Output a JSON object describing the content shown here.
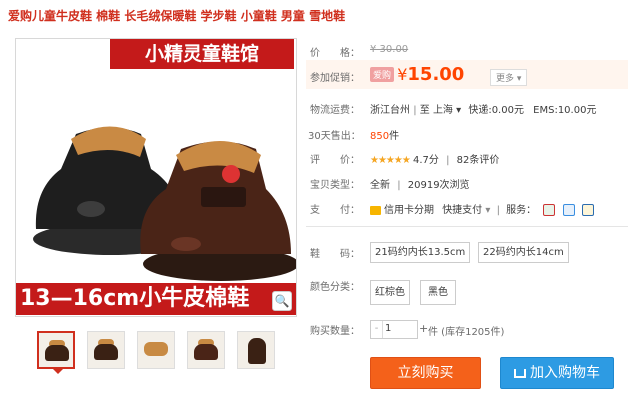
{
  "product": {
    "title": "爱购儿童牛皮鞋 棉鞋 长毛绒保暖鞋 学步鞋 小童鞋 男童 雪地鞋"
  },
  "image": {
    "banner_top": "小精灵童鞋馆",
    "banner_bottom": "13—16cm小牛皮棉鞋"
  },
  "price": {
    "label": "价　　格：",
    "original": "¥ 30.00",
    "promo_label": "参加促销：",
    "promo_tag": "爱购",
    "currency": "¥",
    "current": "15.00",
    "more_label": "更多 ▾"
  },
  "shipping": {
    "label": "物流运费：",
    "from": "浙江台州",
    "sep": "至",
    "to": "上海 ▾",
    "express": "快递:0.00元",
    "ems": "EMS:10.00元"
  },
  "sales": {
    "label": "30天售出：",
    "count": "850",
    "unit": "件"
  },
  "rating": {
    "label": "评　　价：",
    "stars": "★★★★★",
    "score": "4.7分",
    "sep": "|",
    "reviews": "82条评价"
  },
  "condition": {
    "label": "宝贝类型：",
    "value": "全新",
    "sep": "|",
    "views": "20919次浏览"
  },
  "payment": {
    "label": "支　　付：",
    "installment": "信用卡分期",
    "quickpay": "快捷支付",
    "dropdown": "▾",
    "sep": "|",
    "service_label": "服务："
  },
  "options": {
    "size_label": "鞋　　码：",
    "sizes": [
      "21码约内长13.5cm",
      "22码约内长14cm"
    ],
    "color_label": "颜色分类：",
    "colors": [
      "红棕色",
      "黑色"
    ]
  },
  "quantity": {
    "label": "购买数量：",
    "minus": "-",
    "value": "1",
    "plus": "+",
    "stock": "件 (库存1205件)"
  },
  "actions": {
    "buy": "立刻购买",
    "cart": "加入购物车"
  },
  "colors": {
    "accent": "#ff4400",
    "buy": "#f4611a",
    "cart": "#2d9be3",
    "banner": "#c41a1a"
  }
}
